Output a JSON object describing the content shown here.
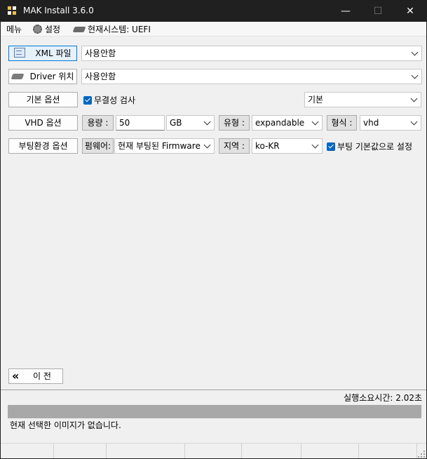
{
  "window": {
    "title": "MAK Install 3.6.0",
    "minimize_icon": "—",
    "maximize_icon": "☐",
    "close_icon": "✕"
  },
  "menu": {
    "menu_label": "메뉴",
    "settings_label": "설정",
    "system_label": "현재시스템: UEFI"
  },
  "xml_row": {
    "button_label": "XML 파일",
    "combo_value": "사용안함"
  },
  "driver_row": {
    "button_label": "Driver 위치",
    "combo_value": "사용안함"
  },
  "basic_row": {
    "button_label": "기본 옵션",
    "integrity_check_label": "무결성 검사",
    "integrity_checked": true,
    "preset_value": "기본"
  },
  "vhd_row": {
    "button_label": "VHD 옵션",
    "size_label": "용량 :",
    "size_value": "50",
    "unit_value": "GB",
    "type_label": "유형 :",
    "type_value": "expandable",
    "format_label": "형식 :",
    "format_value": "vhd"
  },
  "boot_row": {
    "button_label": "부팅환경 옵션",
    "firmware_label": "펌웨어:",
    "firmware_value": "현재 부팅된 Firmware",
    "region_label": "지역 :",
    "region_value": "ko-KR",
    "default_boot_label": "부팅 기본값으로 설정",
    "default_boot_checked": true
  },
  "nav": {
    "prev_icon": "«",
    "prev_label": "이 전"
  },
  "status": {
    "elapsed": "실행소요시간: 2.02초",
    "progress": 0,
    "message": "현재 선택한 이미지가 없습니다."
  },
  "colors": {
    "accent": "#0067c0",
    "titlebar": "#202020",
    "progress": "#a8a8a8"
  }
}
